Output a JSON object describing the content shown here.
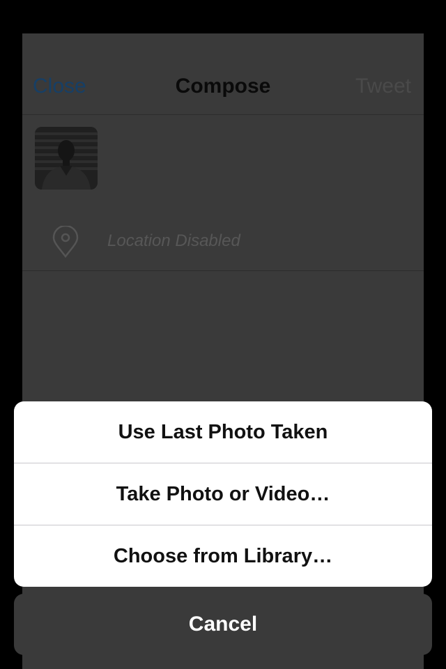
{
  "compose": {
    "close_label": "Close",
    "title": "Compose",
    "tweet_label": "Tweet",
    "location_text": "Location Disabled",
    "location_icon": "location-pin-icon",
    "avatar": "user-avatar-photo"
  },
  "action_sheet": {
    "items": [
      {
        "label": "Use Last Photo Taken"
      },
      {
        "label": "Take Photo or Video…"
      },
      {
        "label": "Choose from Library…"
      }
    ],
    "cancel_label": "Cancel"
  },
  "colors": {
    "overlay_sheet": "#3a3a3a",
    "close_link": "#163f66",
    "action_background": "#ffffff",
    "cancel_background": "#3a3a3a"
  }
}
